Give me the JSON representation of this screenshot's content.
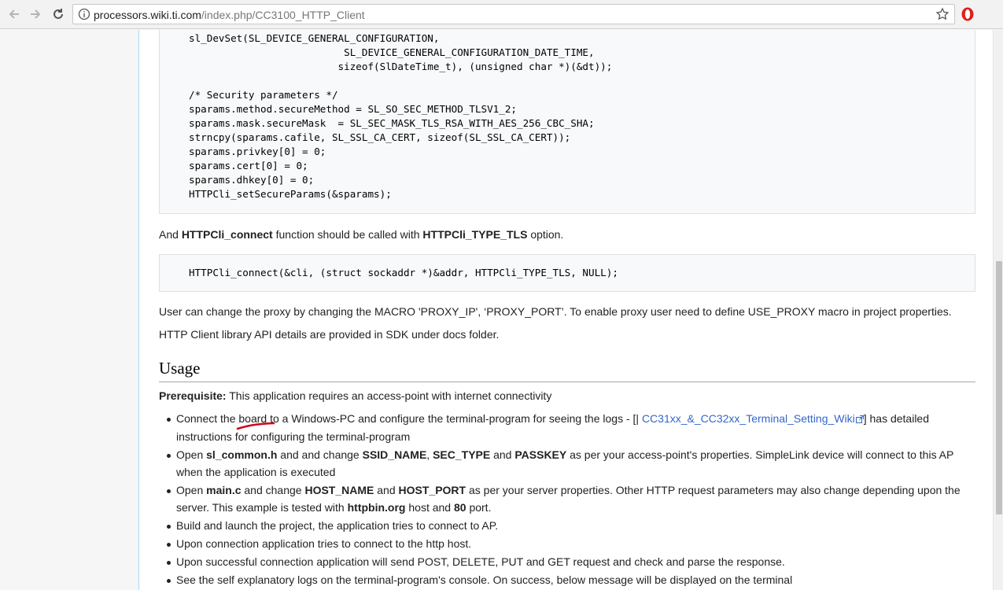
{
  "browser": {
    "url_host": "processors.wiki.ti.com",
    "url_path": "/index.php/CC3100_HTTP_Client"
  },
  "code_block_1": "sl_DevSet(SL_DEVICE_GENERAL_CONFIGURATION,\n                          SL_DEVICE_GENERAL_CONFIGURATION_DATE_TIME,\n                         sizeof(SlDateTime_t), (unsigned char *)(&dt));\n\n/* Security parameters */\nsparams.method.secureMethod = SL_SO_SEC_METHOD_TLSV1_2;\nsparams.mask.secureMask  = SL_SEC_MASK_TLS_RSA_WITH_AES_256_CBC_SHA;\nstrncpy(sparams.cafile, SL_SSL_CA_CERT, sizeof(SL_SSL_CA_CERT));\nsparams.privkey[0] = 0;\nsparams.cert[0] = 0;\nsparams.dhkey[0] = 0;\nHTTPCli_setSecureParams(&sparams);",
  "connect_para": {
    "t1": "And ",
    "b1": "HTTPCli_connect",
    "t2": " function should be called with ",
    "b2": "HTTPCli_TYPE_TLS",
    "t3": " option."
  },
  "code_block_2": "HTTPCli_connect(&cli, (struct sockaddr *)&addr, HTTPCli_TYPE_TLS, NULL);",
  "proxy_para": "User can change the proxy by changing the MACRO 'PROXY_IP', ‘PROXY_PORT’. To enable proxy user need to define USE_PROXY macro in project properties.",
  "api_para": "HTTP Client library API details are provided in SDK under docs folder.",
  "usage_heading": "Usage",
  "prereq": {
    "label": "Prerequisite:",
    "text": " This application requires an access-point with internet connectivity"
  },
  "steps": {
    "s1": {
      "t1": "Connect the board to a Windows-PC and configure the terminal-program for seeing the logs - [| ",
      "link": "CC31xx_&_CC32xx_Terminal_Setting_Wiki",
      "t2": "] has detailed instructions for configuring the terminal-program"
    },
    "s2": {
      "t1": "Open ",
      "b1": "sl_common.h",
      "t2": " and and change ",
      "b2": "SSID_NAME",
      "t3": ", ",
      "b3": "SEC_TYPE",
      "t4": " and ",
      "b4": "PASSKEY",
      "t5": " as per your access-point's properties. SimpleLink device will connect to this AP when the application is executed"
    },
    "s3": {
      "t1": "Open ",
      "b1": "main.c",
      "t2": " and change ",
      "b2": "HOST_NAME",
      "t3": " and ",
      "b3": "HOST_PORT",
      "t4": " as per your server properties. Other HTTP request parameters may also change depending upon the server. This example is tested with ",
      "b4": "httpbin.org",
      "t5": " host and ",
      "b5": "80",
      "t6": " port."
    },
    "s4": "Build and launch the project, the application tries to connect to AP.",
    "s5": "Upon connection application tries to connect to the http host.",
    "s6": "Upon successful connection application will send POST, DELETE, PUT and GET request and check and parse the response.",
    "s7": "See the self explanatory logs on the terminal-program's console. On success, below message will be displayed on the terminal"
  },
  "colors": {
    "link": "#3366cc",
    "annotation": "#d0021b",
    "opera_red": "#e0201b"
  }
}
